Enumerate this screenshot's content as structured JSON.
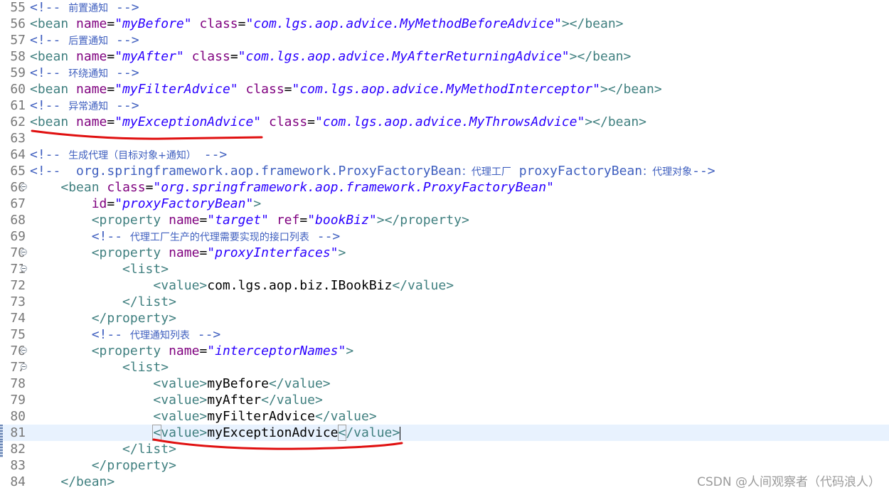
{
  "editor": {
    "current_line": "81",
    "lines": [
      {
        "num": "55",
        "indent": "",
        "parts": [
          {
            "c": "cmt",
            "t": "<!-- "
          },
          {
            "c": "cmt cjk",
            "t": "前置通知"
          },
          {
            "c": "cmt",
            "t": " -->"
          }
        ]
      },
      {
        "num": "56",
        "indent": "",
        "parts": [
          {
            "c": "tag",
            "t": "<bean "
          },
          {
            "c": "attr",
            "t": "name"
          },
          {
            "c": "eq",
            "t": "="
          },
          {
            "c": "val",
            "t": "\"myBefore\""
          },
          {
            "c": "txt",
            "t": " "
          },
          {
            "c": "attr",
            "t": "class"
          },
          {
            "c": "eq",
            "t": "="
          },
          {
            "c": "val",
            "t": "\"com.lgs.aop.advice.MyMethodBeforeAdvice\""
          },
          {
            "c": "tag",
            "t": "></bean>"
          }
        ]
      },
      {
        "num": "57",
        "indent": "",
        "parts": [
          {
            "c": "cmt",
            "t": "<!-- "
          },
          {
            "c": "cmt cjk",
            "t": "后置通知"
          },
          {
            "c": "cmt",
            "t": " -->"
          }
        ]
      },
      {
        "num": "58",
        "indent": "",
        "parts": [
          {
            "c": "tag",
            "t": "<bean "
          },
          {
            "c": "attr",
            "t": "name"
          },
          {
            "c": "eq",
            "t": "="
          },
          {
            "c": "val",
            "t": "\"myAfter\""
          },
          {
            "c": "txt",
            "t": " "
          },
          {
            "c": "attr",
            "t": "class"
          },
          {
            "c": "eq",
            "t": "="
          },
          {
            "c": "val",
            "t": "\"com.lgs.aop.advice.MyAfterReturningAdvice\""
          },
          {
            "c": "tag",
            "t": "></bean>"
          }
        ]
      },
      {
        "num": "59",
        "indent": "",
        "parts": [
          {
            "c": "cmt",
            "t": "<!-- "
          },
          {
            "c": "cmt cjk",
            "t": "环绕通知"
          },
          {
            "c": "cmt",
            "t": " -->"
          }
        ]
      },
      {
        "num": "60",
        "indent": "",
        "parts": [
          {
            "c": "tag",
            "t": "<bean "
          },
          {
            "c": "attr",
            "t": "name"
          },
          {
            "c": "eq",
            "t": "="
          },
          {
            "c": "val",
            "t": "\"myFilterAdvice\""
          },
          {
            "c": "txt",
            "t": " "
          },
          {
            "c": "attr",
            "t": "class"
          },
          {
            "c": "eq",
            "t": "="
          },
          {
            "c": "val",
            "t": "\"com.lgs.aop.advice.MyMethodInterceptor\""
          },
          {
            "c": "tag",
            "t": "></bean>"
          }
        ]
      },
      {
        "num": "61",
        "indent": "",
        "parts": [
          {
            "c": "cmt",
            "t": "<!-- "
          },
          {
            "c": "cmt cjk",
            "t": "异常通知"
          },
          {
            "c": "cmt",
            "t": " -->"
          }
        ]
      },
      {
        "num": "62",
        "indent": "",
        "parts": [
          {
            "c": "tag",
            "t": "<bean "
          },
          {
            "c": "attr",
            "t": "name"
          },
          {
            "c": "eq",
            "t": "="
          },
          {
            "c": "val",
            "t": "\"myExceptionAdvice\""
          },
          {
            "c": "txt",
            "t": " "
          },
          {
            "c": "attr",
            "t": "class"
          },
          {
            "c": "eq",
            "t": "="
          },
          {
            "c": "val",
            "t": "\"com.lgs.aop.advice.MyThrowsAdvice\""
          },
          {
            "c": "tag",
            "t": "></bean>"
          }
        ]
      },
      {
        "num": "63",
        "indent": "",
        "parts": []
      },
      {
        "num": "64",
        "indent": "",
        "parts": [
          {
            "c": "cmt",
            "t": "<!-- "
          },
          {
            "c": "cmt cjk",
            "t": "生成代理（目标对象+通知）"
          },
          {
            "c": "cmt",
            "t": " -->"
          }
        ]
      },
      {
        "num": "65",
        "indent": "",
        "parts": [
          {
            "c": "cmt",
            "t": "<!--  org.springframework.aop.framework.ProxyFactoryBean"
          },
          {
            "c": "cmt cjk",
            "t": "：代理工厂"
          },
          {
            "c": "cmt",
            "t": " proxyFactoryBean"
          },
          {
            "c": "cmt cjk",
            "t": "：代理对象"
          },
          {
            "c": "cmt",
            "t": "-->"
          }
        ]
      },
      {
        "num": "66",
        "indent": "    ",
        "fold": true,
        "parts": [
          {
            "c": "tag",
            "t": "<bean "
          },
          {
            "c": "attr",
            "t": "class"
          },
          {
            "c": "eq",
            "t": "="
          },
          {
            "c": "val",
            "t": "\"org.springframework.aop.framework.ProxyFactoryBean\""
          }
        ]
      },
      {
        "num": "67",
        "indent": "        ",
        "parts": [
          {
            "c": "attr",
            "t": "id"
          },
          {
            "c": "eq",
            "t": "="
          },
          {
            "c": "val",
            "t": "\"proxyFactoryBean\""
          },
          {
            "c": "tag",
            "t": ">"
          }
        ]
      },
      {
        "num": "68",
        "indent": "        ",
        "parts": [
          {
            "c": "tag",
            "t": "<property "
          },
          {
            "c": "attr",
            "t": "name"
          },
          {
            "c": "eq",
            "t": "="
          },
          {
            "c": "val",
            "t": "\"target\""
          },
          {
            "c": "txt",
            "t": " "
          },
          {
            "c": "attr",
            "t": "ref"
          },
          {
            "c": "eq",
            "t": "="
          },
          {
            "c": "val",
            "t": "\"bookBiz\""
          },
          {
            "c": "tag",
            "t": "></property>"
          }
        ]
      },
      {
        "num": "69",
        "indent": "        ",
        "parts": [
          {
            "c": "cmt",
            "t": "<!-- "
          },
          {
            "c": "cmt cjk",
            "t": "代理工厂生产的代理需要实现的接口列表"
          },
          {
            "c": "cmt",
            "t": " -->"
          }
        ]
      },
      {
        "num": "70",
        "indent": "        ",
        "fold": true,
        "parts": [
          {
            "c": "tag",
            "t": "<property "
          },
          {
            "c": "attr",
            "t": "name"
          },
          {
            "c": "eq",
            "t": "="
          },
          {
            "c": "val",
            "t": "\"proxyInterfaces\""
          },
          {
            "c": "tag",
            "t": ">"
          }
        ]
      },
      {
        "num": "71",
        "indent": "            ",
        "fold": true,
        "parts": [
          {
            "c": "tag",
            "t": "<list>"
          }
        ]
      },
      {
        "num": "72",
        "indent": "                ",
        "parts": [
          {
            "c": "tag",
            "t": "<value>"
          },
          {
            "c": "txt",
            "t": "com.lgs.aop.biz.IBookBiz"
          },
          {
            "c": "tag",
            "t": "</value>"
          }
        ]
      },
      {
        "num": "73",
        "indent": "            ",
        "parts": [
          {
            "c": "tag",
            "t": "</list>"
          }
        ]
      },
      {
        "num": "74",
        "indent": "        ",
        "parts": [
          {
            "c": "tag",
            "t": "</property>"
          }
        ]
      },
      {
        "num": "75",
        "indent": "        ",
        "parts": [
          {
            "c": "cmt",
            "t": "<!-- "
          },
          {
            "c": "cmt cjk",
            "t": "代理通知列表"
          },
          {
            "c": "cmt",
            "t": " -->"
          }
        ]
      },
      {
        "num": "76",
        "indent": "        ",
        "fold": true,
        "parts": [
          {
            "c": "tag",
            "t": "<property "
          },
          {
            "c": "attr",
            "t": "name"
          },
          {
            "c": "eq",
            "t": "="
          },
          {
            "c": "val",
            "t": "\"interceptorNames\""
          },
          {
            "c": "tag",
            "t": ">"
          }
        ]
      },
      {
        "num": "77",
        "indent": "            ",
        "fold": true,
        "parts": [
          {
            "c": "tag",
            "t": "<list>"
          }
        ]
      },
      {
        "num": "78",
        "indent": "                ",
        "parts": [
          {
            "c": "tag",
            "t": "<value>"
          },
          {
            "c": "txt",
            "t": "myBefore"
          },
          {
            "c": "tag",
            "t": "</value>"
          }
        ]
      },
      {
        "num": "79",
        "indent": "                ",
        "parts": [
          {
            "c": "tag",
            "t": "<value>"
          },
          {
            "c": "txt",
            "t": "myAfter"
          },
          {
            "c": "tag",
            "t": "</value>"
          }
        ]
      },
      {
        "num": "80",
        "indent": "                ",
        "parts": [
          {
            "c": "tag",
            "t": "<value>"
          },
          {
            "c": "txt",
            "t": "myFilterAdvice"
          },
          {
            "c": "tag",
            "t": "</value>"
          }
        ]
      },
      {
        "num": "81",
        "indent": "                ",
        "current": true,
        "marker": true,
        "parts": [
          {
            "c": "tag bracket-box",
            "t": "<"
          },
          {
            "c": "tag",
            "t": "value>"
          },
          {
            "c": "txt",
            "t": "myExceptionAdvice"
          },
          {
            "c": "tag bracket-box",
            "t": "<"
          },
          {
            "c": "tag",
            "t": "/value>"
          },
          {
            "c": "caret",
            "t": ""
          }
        ]
      },
      {
        "num": "82",
        "indent": "            ",
        "marker": true,
        "parts": [
          {
            "c": "tag",
            "t": "</list>"
          }
        ]
      },
      {
        "num": "83",
        "indent": "        ",
        "parts": [
          {
            "c": "tag",
            "t": "</property>"
          }
        ]
      },
      {
        "num": "84",
        "indent": "    ",
        "parts": [
          {
            "c": "tag",
            "t": "</bean>"
          }
        ]
      }
    ]
  },
  "annotation": {
    "stroke_color": "#e01010",
    "underlines": [
      "line-62-name-attribute",
      "line-81-value-element"
    ]
  },
  "watermark": {
    "text": "CSDN @人间观察者（代码浪人）"
  },
  "colors": {
    "comment": "#3f5fbf",
    "tag": "#3f7f7f",
    "attribute": "#7f007f",
    "attribute_value": "#2a00ff",
    "current_line": "#e8f2fe"
  }
}
